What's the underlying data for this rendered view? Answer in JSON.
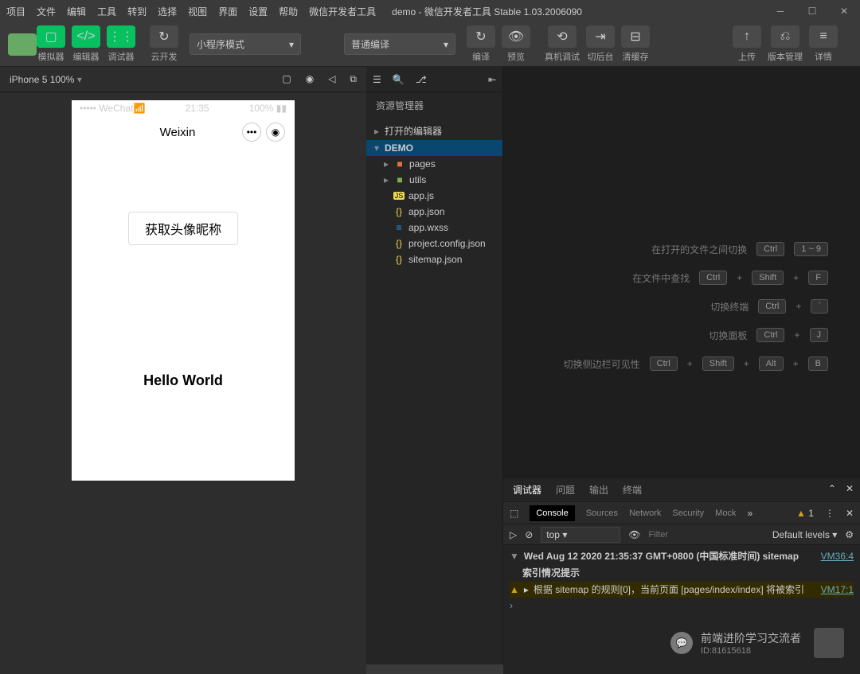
{
  "titlebar": {
    "menu": [
      "项目",
      "文件",
      "编辑",
      "工具",
      "转到",
      "选择",
      "视图",
      "界面",
      "设置",
      "帮助",
      "微信开发者工具"
    ],
    "app_name": "demo",
    "app_sub": "- 微信开发者工具 Stable 1.03.2006090"
  },
  "toolbar": {
    "simulator": "模拟器",
    "editor": "编辑器",
    "debugger": "调试器",
    "cloud": "云开发",
    "mode_dropdown": "小程序模式",
    "compile_dropdown": "普通编译",
    "compile": "编译",
    "preview": "预览",
    "real_debug": "真机调试",
    "backstage": "切后台",
    "clear_cache": "清缓存",
    "upload": "上传",
    "version": "版本管理",
    "details": "详情"
  },
  "simulator": {
    "device": "iPhone 5 100%",
    "status_carrier": "••••• WeChat",
    "status_time": "21:35",
    "status_battery": "100%",
    "nav_title": "Weixin",
    "main_button": "获取头像昵称",
    "hello": "Hello World"
  },
  "explorer": {
    "title": "资源管理器",
    "section_editors": "打开的编辑器",
    "project": "DEMO",
    "tree": [
      {
        "icon": "📁",
        "name": "pages",
        "color": "#e57339"
      },
      {
        "icon": "📁",
        "name": "utils",
        "color": "#7cb342"
      },
      {
        "icon": "JS",
        "name": "app.js",
        "color": "#f0db4f",
        "bg": "#f0db4f"
      },
      {
        "icon": "{}",
        "name": "app.json",
        "color": "#f0db4f"
      },
      {
        "icon": "≡",
        "name": "app.wxss",
        "color": "#2196f3"
      },
      {
        "icon": "{}",
        "name": "project.config.json",
        "color": "#f0db4f"
      },
      {
        "icon": "{}",
        "name": "sitemap.json",
        "color": "#f0db4f"
      }
    ]
  },
  "shortcuts": [
    {
      "label": "在打开的文件之间切换",
      "keys": [
        "Ctrl",
        "1 ~ 9"
      ]
    },
    {
      "label": "在文件中查找",
      "keys": [
        "Ctrl",
        "+",
        "Shift",
        "+",
        "F"
      ]
    },
    {
      "label": "切换终端",
      "keys": [
        "Ctrl",
        "+",
        "`"
      ]
    },
    {
      "label": "切换面板",
      "keys": [
        "Ctrl",
        "+",
        "J"
      ]
    },
    {
      "label": "切换侧边栏可见性",
      "keys": [
        "Ctrl",
        "+",
        "Shift",
        "+",
        "Alt",
        "+",
        "B"
      ]
    }
  ],
  "debugger": {
    "tabs": [
      "调试器",
      "问题",
      "输出",
      "终端"
    ],
    "devtools_tabs": [
      "Console",
      "Sources",
      "Network",
      "Security",
      "Mock"
    ],
    "warn_count": "1",
    "top_context": "top",
    "filter_placeholder": "Filter",
    "levels": "Default levels ▾",
    "log1_time": "Wed Aug 12 2020 21:35:37 GMT+0800 (中国标准时间)",
    "log1_tag": "sitemap",
    "log1_sub": "索引情况提示",
    "log1_loc": "VM36:4",
    "log2_text": "根据 sitemap 的规则[0]，当前页面 [pages/index/index] 将被索引",
    "log2_loc": "VM17:1"
  },
  "watermark": {
    "line1": "前端进阶学习交流者",
    "line2": "ID:81615618"
  }
}
